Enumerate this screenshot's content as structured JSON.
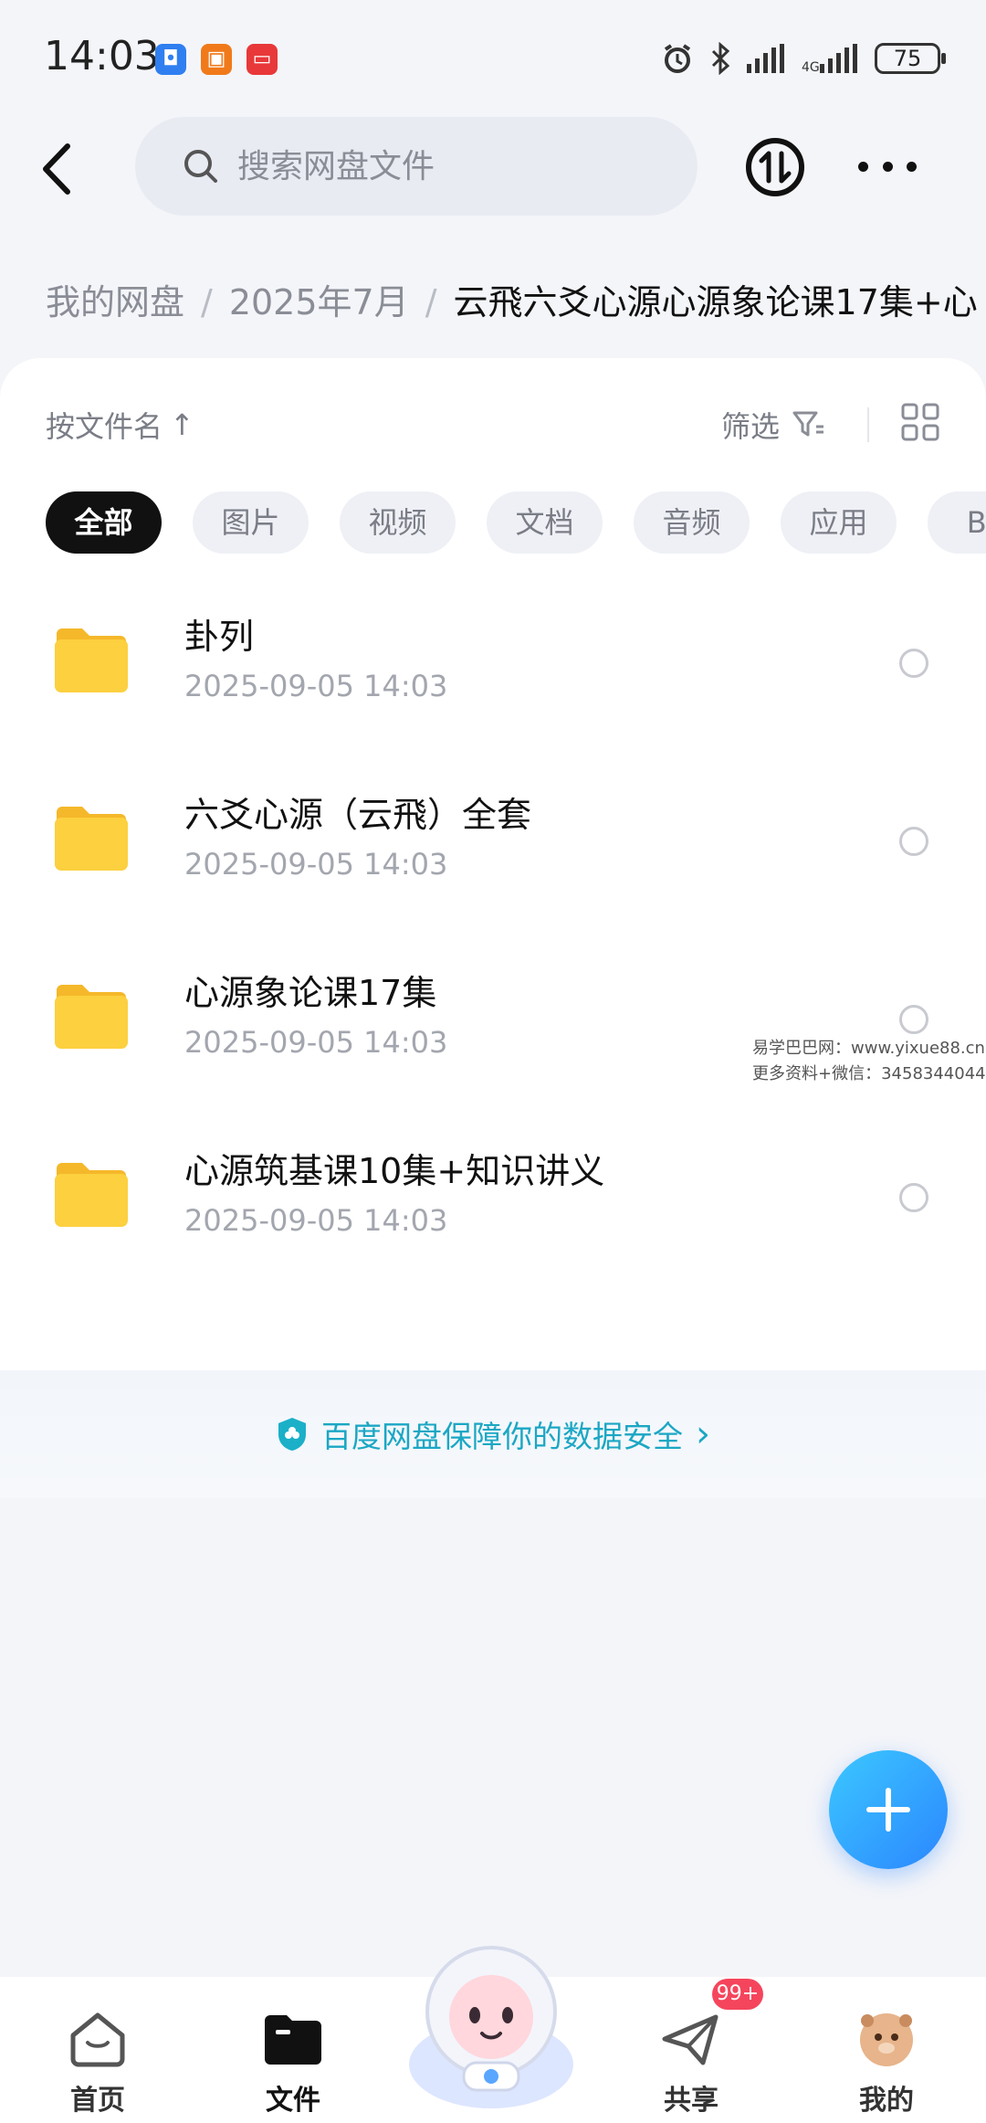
{
  "status": {
    "time": "14:03",
    "battery": "75"
  },
  "search": {
    "placeholder": "搜索网盘文件"
  },
  "breadcrumb": {
    "items": [
      "我的网盘",
      "2025年7月",
      "云飛六爻心源心源象论课17集+心"
    ]
  },
  "sort": {
    "label": "按文件名",
    "arrow": "↑"
  },
  "filter": {
    "label": "筛选"
  },
  "chips": [
    "全部",
    "图片",
    "视频",
    "文档",
    "音频",
    "应用",
    "BT"
  ],
  "files": [
    {
      "name": "卦列",
      "date": "2025-09-05  14:03"
    },
    {
      "name": "六爻心源（云飛）全套",
      "date": "2025-09-05  14:03"
    },
    {
      "name": "心源象论课17集",
      "date": "2025-09-05  14:03"
    },
    {
      "name": "心源筑基课10集+知识讲义",
      "date": "2025-09-05  14:03"
    }
  ],
  "safety": {
    "text": "百度网盘保障你的数据安全",
    "chevron": "›"
  },
  "watermark": {
    "line1": "易学巴巴网：www.yixue88.cn",
    "line2": "更多资料+微信：3458344044"
  },
  "nav": {
    "home": "首页",
    "files": "文件",
    "share": "共享",
    "mine": "我的",
    "share_badge": "99+"
  },
  "colors": {
    "accent": "#2b86ff",
    "safety_text": "#1ba7c4",
    "folder": "#fcc93a",
    "badge": "#f5455c"
  }
}
